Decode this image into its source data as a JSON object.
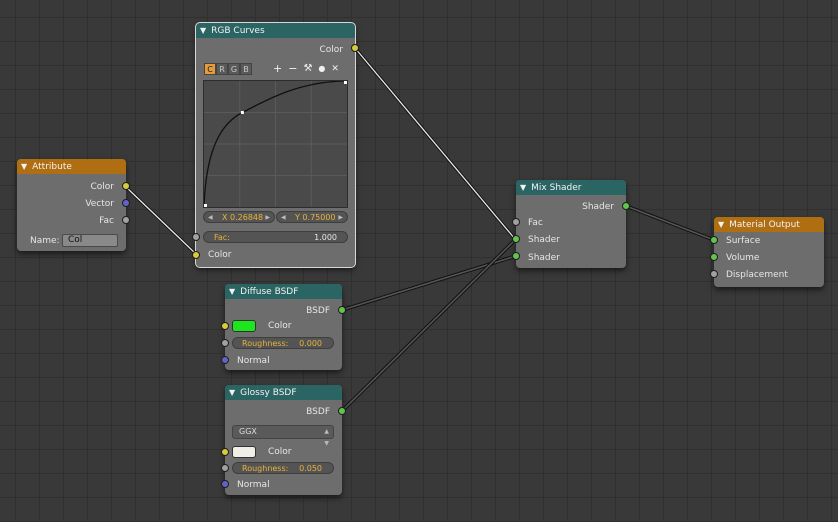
{
  "nodes": {
    "rgb_curves": {
      "title": "RGB Curves",
      "output_color": "Color",
      "channels": [
        "C",
        "R",
        "G",
        "B"
      ],
      "tools": {
        "add": "+",
        "remove": "−",
        "wrench": "⚒",
        "dot": "●",
        "close": "✕"
      },
      "curve_point_x": "X 0.26848",
      "curve_point_y": "Y 0.75000",
      "fac_label": "Fac:",
      "fac_value": "1.000",
      "input_color": "Color",
      "curve": {
        "points": [
          [
            0,
            0
          ],
          [
            0.26848,
            0.75
          ],
          [
            1,
            1
          ]
        ]
      }
    },
    "attribute": {
      "title": "Attribute",
      "outputs": [
        "Color",
        "Vector",
        "Fac"
      ],
      "name_label": "Name:",
      "name_value": "Col"
    },
    "mix_shader": {
      "title": "Mix Shader",
      "output": "Shader",
      "inputs": [
        "Fac",
        "Shader",
        "Shader"
      ]
    },
    "material_output": {
      "title": "Material Output",
      "inputs": [
        "Surface",
        "Volume",
        "Displacement"
      ]
    },
    "diffuse_bsdf": {
      "title": "Diffuse BSDF",
      "output": "BSDF",
      "color_label": "Color",
      "color_value": "#1ee61e",
      "roughness_label": "Roughness:",
      "roughness_value": "0.000",
      "normal_label": "Normal"
    },
    "glossy_bsdf": {
      "title": "Glossy BSDF",
      "output": "BSDF",
      "distribution": "GGX",
      "color_label": "Color",
      "color_value": "#efefe8",
      "roughness_label": "Roughness:",
      "roughness_value": "0.050",
      "normal_label": "Normal"
    }
  }
}
